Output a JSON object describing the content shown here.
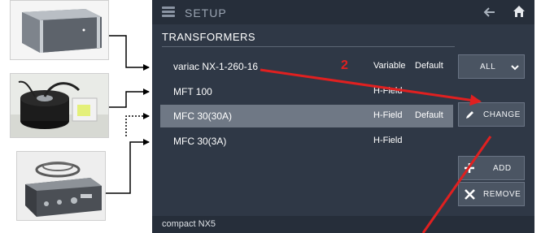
{
  "header": {
    "title": "SETUP"
  },
  "section": {
    "title": "TRANSFORMERS"
  },
  "rows": [
    {
      "name": "variac NX-1-260-16",
      "type": "Variable",
      "default": "Default"
    },
    {
      "name": "MFT 100",
      "type": "H-Field",
      "default": ""
    },
    {
      "name": "MFC 30(30A)",
      "type": "H-Field",
      "default": "Default"
    },
    {
      "name": "MFC 30(3A)",
      "type": "H-Field",
      "default": ""
    }
  ],
  "filter": {
    "selected": "ALL"
  },
  "buttons": {
    "change": "CHANGE",
    "add": "ADD",
    "remove": "REMOVE"
  },
  "footer": {
    "device": "compact NX5"
  },
  "annotation": {
    "step": "2"
  },
  "colors": {
    "panel_bg": "#2f3846",
    "selected_row": "#6f7885",
    "annotation_red": "#e02020"
  },
  "icons": [
    "menu-icon",
    "back-arrow-icon",
    "home-icon",
    "chevron-down-icon",
    "pencil-icon",
    "plus-icon",
    "close-icon"
  ]
}
